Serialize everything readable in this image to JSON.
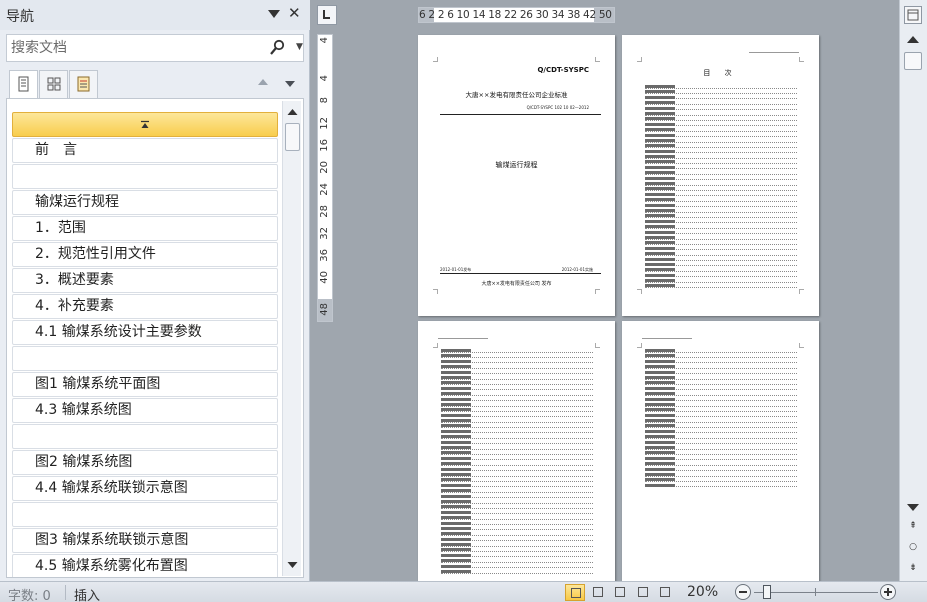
{
  "nav": {
    "title": "导航",
    "search_placeholder": "搜索文档",
    "headings": [
      "",
      "前　言",
      "",
      "输煤运行规程",
      "1．范围",
      "2．规范性引用文件",
      "3．概述要素",
      "4．补充要素",
      "4.1 输煤系统设计主要参数",
      "",
      "图1 输煤系统平面图",
      "4.3 输煤系统图",
      "",
      "图2 输煤系统图",
      "4.4 输煤系统联锁示意图",
      "",
      "图3 输煤系统联锁示意图",
      "4.5 输煤系统雾化布置图"
    ]
  },
  "ruler": {
    "horizontal": "6  2 2  6  10 14  18 22 26 30 34 38 42    50",
    "vertical": [
      "4",
      "4",
      "8",
      "12",
      "16",
      "20",
      "24",
      "28",
      "32",
      "36",
      "40",
      "48"
    ]
  },
  "pages": {
    "p1": {
      "code": "Q/CDT-SYSPC",
      "company": "大唐××发电有限责任公司企业标准",
      "number": "Q/CDT-SYSPC 102 10 02—2012",
      "title": "输煤运行规程",
      "date_left": "2012-01-01发布",
      "date_right": "2012-01-01实施",
      "footer": "大唐××发电有限责任公司 发布"
    },
    "p2": {
      "title": "目 次"
    }
  },
  "status": {
    "word_count": "字数: 0",
    "mode": "插入",
    "zoom": "20%"
  },
  "colors": {
    "selected_heading": "#f8cd4d",
    "workspace": "#9fa6ae",
    "nav_bg": "#e9edf3"
  }
}
